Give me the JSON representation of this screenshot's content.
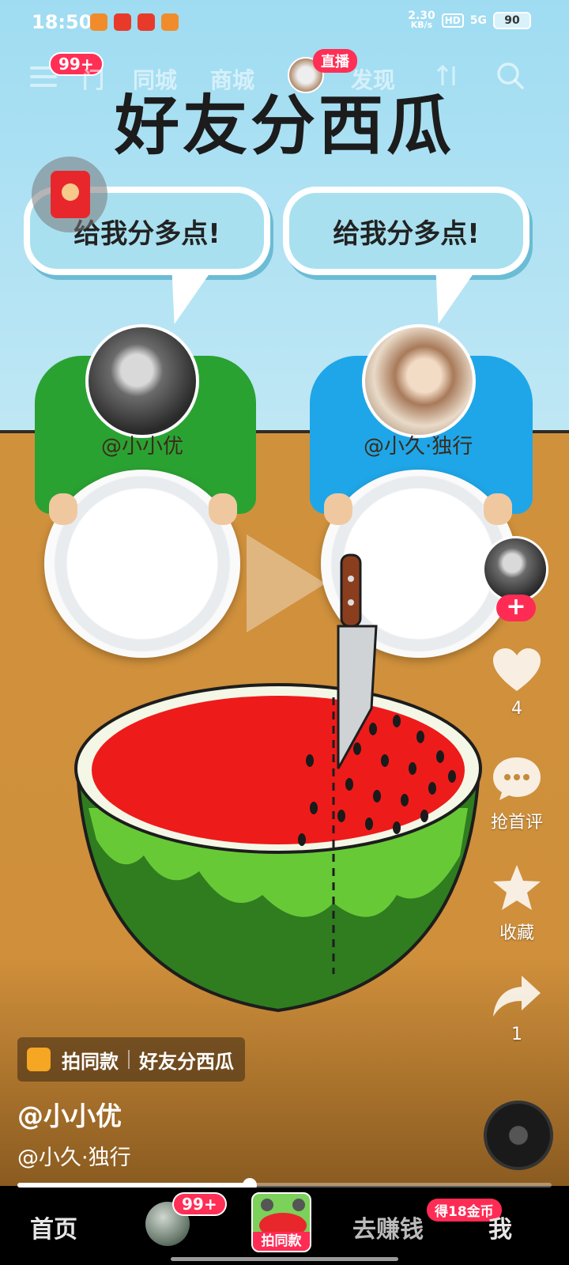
{
  "status_bar": {
    "time": "18:50",
    "net_speed_value": "2.30",
    "net_speed_unit": "KB/s",
    "hd": "HD",
    "signal": "5G",
    "battery": "90"
  },
  "top_nav": {
    "menu_badge": "99+",
    "tabs": [
      "门",
      "同城",
      "商城",
      "发现"
    ],
    "live_label": "直播"
  },
  "video": {
    "title": "好友分西瓜",
    "bubble_left": "给我分多点!",
    "bubble_right": "给我分多点!",
    "name_left": "@小小优",
    "name_right": "@小久·独行"
  },
  "rail": {
    "like_count": "4",
    "comment_label": "抢首评",
    "favorite_label": "收藏",
    "share_count": "1",
    "follow_symbol": "+"
  },
  "caption": {
    "template_action": "拍同款",
    "template_name": "好友分西瓜",
    "author": "@小小优",
    "mention": "@小久·独行"
  },
  "progress": {
    "played_fraction": 0.435
  },
  "bottom_nav": {
    "home": "首页",
    "friends_badge": "99+",
    "shoot_label": "拍同款",
    "earn": "去赚钱",
    "earn_badge": "得18金币",
    "me": "我"
  },
  "colors": {
    "accent": "#fe2c55",
    "sky": "#9fdcf2",
    "table": "#d0913c"
  }
}
